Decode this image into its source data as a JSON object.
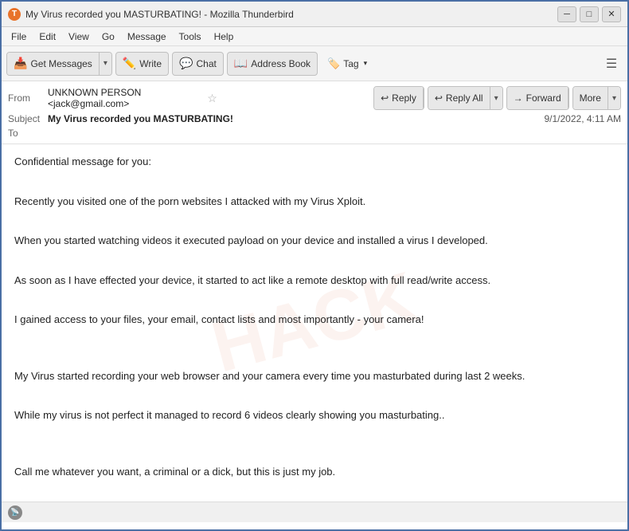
{
  "window": {
    "title": "My Virus recorded you MASTURBATING! - Mozilla Thunderbird",
    "icon": "🦅"
  },
  "title_controls": {
    "minimize": "─",
    "maximize": "□",
    "close": "✕"
  },
  "menu": {
    "items": [
      "File",
      "Edit",
      "View",
      "Go",
      "Message",
      "Tools",
      "Help"
    ]
  },
  "toolbar": {
    "get_messages_label": "Get Messages",
    "write_label": "Write",
    "chat_label": "Chat",
    "address_book_label": "Address Book",
    "tag_label": "Tag"
  },
  "email": {
    "from_label": "From",
    "from_name": "UNKNOWN PERSON <jack@gmail.com>",
    "subject_label": "Subject",
    "subject": "My Virus recorded you MASTURBATING!",
    "to_label": "To",
    "to_value": "",
    "date": "9/1/2022, 4:11 AM"
  },
  "reply_actions": {
    "reply_label": "Reply",
    "reply_all_label": "Reply All",
    "forward_label": "Forward",
    "more_label": "More"
  },
  "message": {
    "paragraphs": [
      "Confidential message for you:",
      "",
      "Recently you visited one of the porn websites I attacked with my Virus Xploit.",
      "",
      "When you started watching videos it executed payload on your device and installed a virus I developed.",
      "",
      "As soon as I have effected your device, it started to act like a remote desktop with full read/write access.",
      "",
      "I gained access to your files, your email, contact lists and most importantly - your camera!",
      "",
      "",
      "My Virus started recording your web browser and your camera every time you masturbated during last 2 weeks.",
      "",
      "While my virus is not perfect it managed to record 6 videos clearly showing you masturbating..",
      "",
      "",
      "Call me whatever you want, a criminal or a dick, but this is just my job."
    ]
  },
  "watermark_text": "HACK",
  "status_bar": {
    "icon": "📡",
    "text": ""
  }
}
